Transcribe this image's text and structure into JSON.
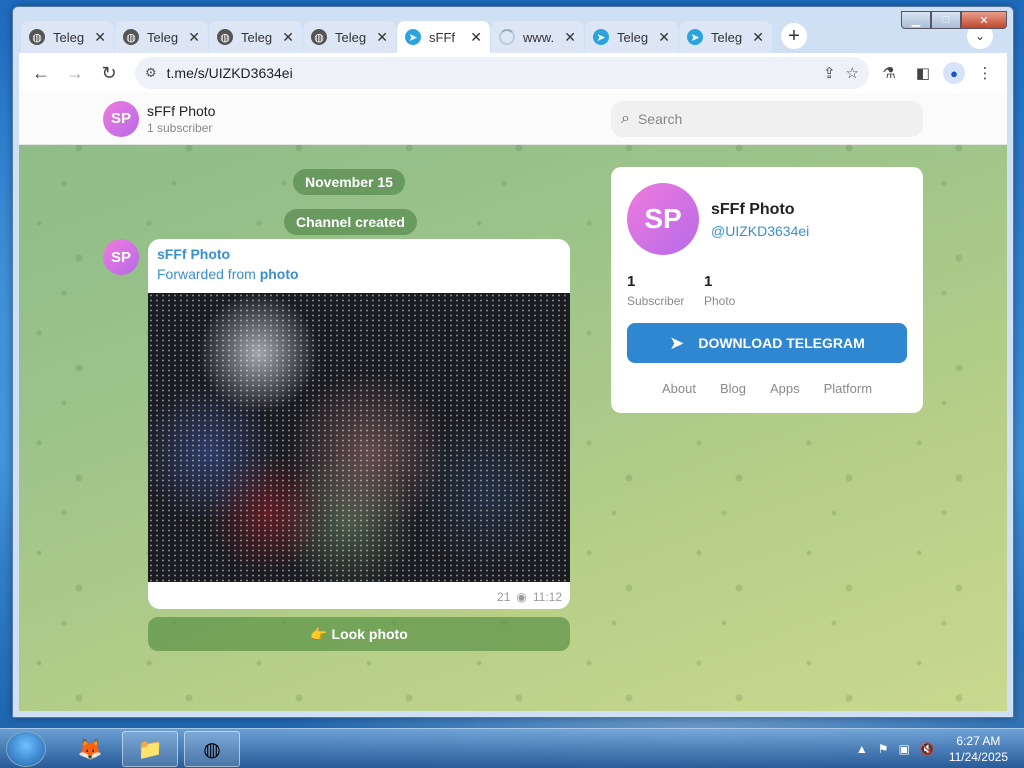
{
  "browser": {
    "tabs": [
      {
        "title": "Teleg",
        "icon": "globe-icon",
        "active": false
      },
      {
        "title": "Teleg",
        "icon": "globe-icon",
        "active": false
      },
      {
        "title": "Teleg",
        "icon": "globe-icon",
        "active": false
      },
      {
        "title": "Teleg",
        "icon": "globe-icon",
        "active": false
      },
      {
        "title": "sFFf",
        "icon": "telegram-icon",
        "active": true
      },
      {
        "title": "www.",
        "icon": "loading-icon",
        "active": false
      },
      {
        "title": "Teleg",
        "icon": "telegram-icon",
        "active": false
      },
      {
        "title": "Teleg",
        "icon": "telegram-icon",
        "active": false
      }
    ],
    "url": "t.me/s/UIZKD3634ei"
  },
  "channel": {
    "initials": "SP",
    "title": "sFFf Photo",
    "subscribers_line": "1 subscriber",
    "handle": "@UIZKD3634ei"
  },
  "search": {
    "placeholder": "Search"
  },
  "feed": {
    "date_label": "November 15",
    "service_label": "Channel created",
    "message": {
      "author": "sFFf Photo",
      "forwarded_prefix": "Forwarded from ",
      "forwarded_source": "photo",
      "views": "21",
      "time": "11:12"
    },
    "button_label": "👉 Look photo"
  },
  "side_card": {
    "stats": [
      {
        "value": "1",
        "label": "Subscriber"
      },
      {
        "value": "1",
        "label": "Photo"
      }
    ],
    "download_label": "DOWNLOAD TELEGRAM",
    "links": [
      "About",
      "Blog",
      "Apps",
      "Platform"
    ]
  },
  "colors": {
    "accent": "#2f87d1",
    "link": "#3a8fcc",
    "avatar": "#c46ee6"
  },
  "taskbar": {
    "time": "6:27 AM",
    "date": "11/24/2025"
  }
}
